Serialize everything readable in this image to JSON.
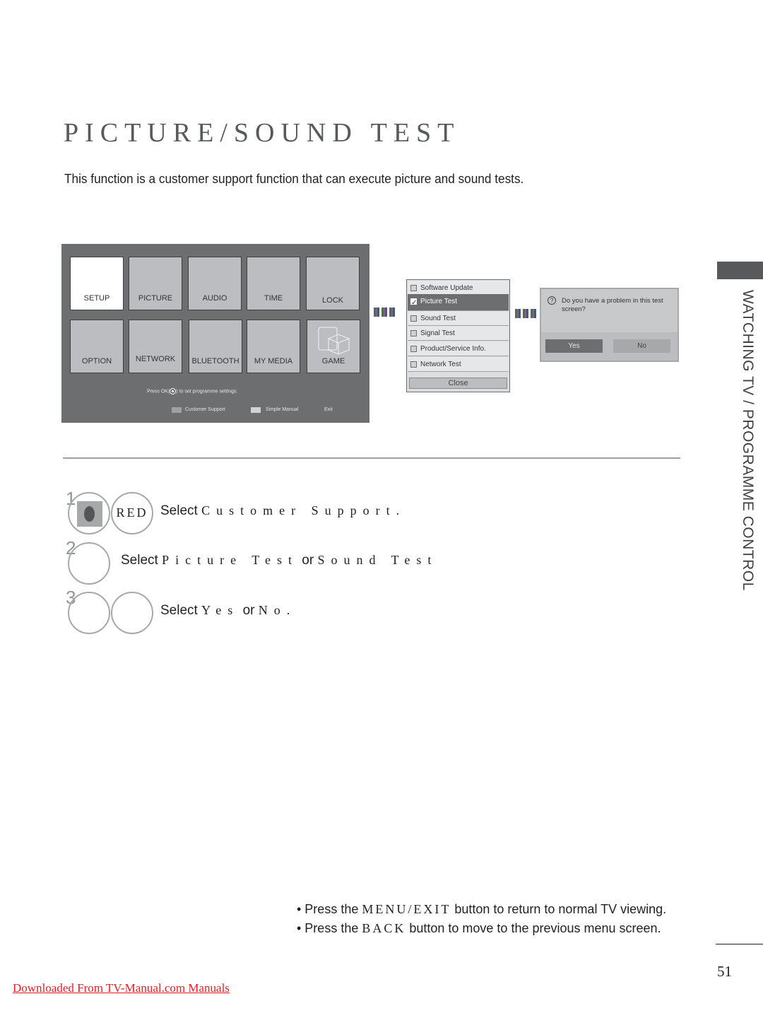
{
  "page": {
    "title": "PICTURE/SOUND TEST",
    "intro": "This function is a customer support function that can execute picture and sound tests.",
    "section_tab": "WATCHING TV / PROGRAMME CONTROL",
    "page_number": "51",
    "download_link": "Downloaded From TV-Manual.com Manuals"
  },
  "tv_menu": {
    "tiles_row1": [
      "SETUP",
      "PICTURE",
      "AUDIO",
      "TIME",
      "LOCK"
    ],
    "tiles_row2": [
      "OPTION",
      "NETWORK",
      "BLUETOOTH",
      "MY MEDIA",
      "GAME"
    ],
    "selected": "SETUP",
    "hint_prefix": "Press OK(",
    "hint_suffix": ") to set programme settings.",
    "legend": [
      {
        "label": "Customer Support",
        "color": "#9fa0a2"
      },
      {
        "label": "Simple Manual",
        "color": "#d1d2d4"
      },
      {
        "label": "Exit"
      }
    ]
  },
  "customer_support": {
    "items": [
      {
        "label": "Software Update",
        "checked": false
      },
      {
        "label": "Picture Test",
        "checked": true
      },
      {
        "label": "Sound Test",
        "checked": false
      },
      {
        "label": "Signal Test",
        "checked": false
      },
      {
        "label": "Product/Service Info.",
        "checked": false
      },
      {
        "label": "Network Test",
        "checked": false
      }
    ],
    "close_label": "Close"
  },
  "dialog": {
    "message": "Do you have a problem in this test screen?",
    "yes_label": "Yes",
    "no_label": "No"
  },
  "steps": [
    {
      "number": "1",
      "button_label": "RED",
      "prefix": "Select ",
      "target": "Customer Support."
    },
    {
      "number": "2",
      "prefix": "Select ",
      "target1": "Picture Test",
      "joiner": " or ",
      "target2": "Sound Test"
    },
    {
      "number": "3",
      "prefix": "Select ",
      "target1": "Yes",
      "joiner": " or ",
      "target2": "No."
    }
  ],
  "notes": [
    {
      "prefix": "• Press the ",
      "key": "MENU/EXIT",
      "suffix": " button to return to normal TV viewing."
    },
    {
      "prefix": "• Press the ",
      "key": "BACK",
      "suffix": " button to move to the previous menu screen."
    }
  ]
}
